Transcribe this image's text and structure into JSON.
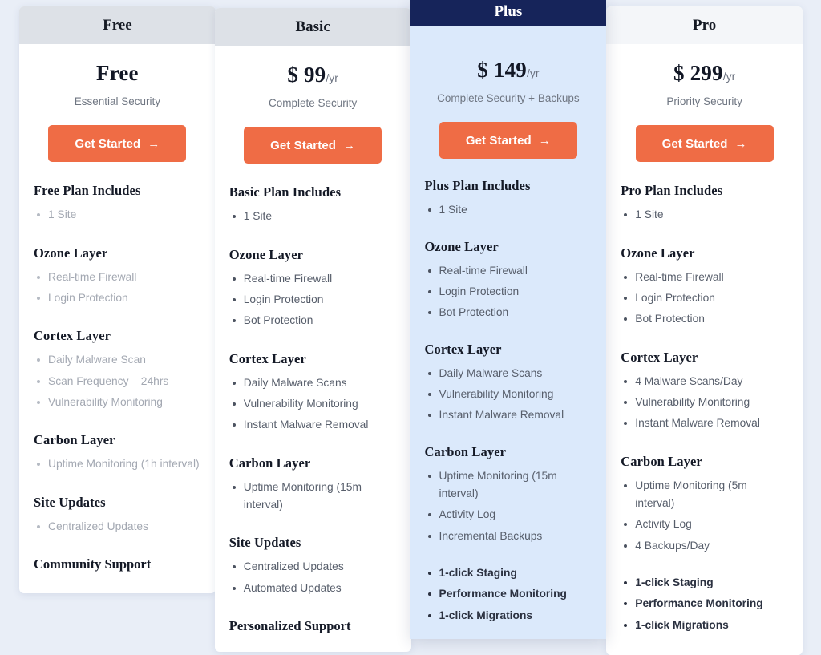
{
  "theme": {
    "page_background": "#e9eef7",
    "cta_color": "#ef6c45",
    "featured_header": "#16245a",
    "featured_body": "#dbe9fb",
    "header_gray": "#dde1e7"
  },
  "cta": {
    "label": "Get Started",
    "arrow": "→"
  },
  "plans": [
    {
      "name": "Free",
      "price": "Free",
      "period": "",
      "tagline": "Essential Security",
      "includes_title": "Free Plan Includes",
      "includes": [
        "1 Site"
      ],
      "sections": [
        {
          "title": "Ozone Layer",
          "items": [
            "Real-time Firewall",
            "Login Protection"
          ]
        },
        {
          "title": "Cortex Layer",
          "items": [
            "Daily Malware Scan",
            "Scan Frequency – 24hrs",
            "Vulnerability Monitoring"
          ]
        },
        {
          "title": "Carbon Layer",
          "items": [
            "Uptime Monitoring (1h interval)"
          ]
        },
        {
          "title": "Site Updates",
          "items": [
            "Centralized Updates"
          ]
        }
      ],
      "footer_title": "Community Support",
      "extras": []
    },
    {
      "name": "Basic",
      "price": "$ 99",
      "period": "/yr",
      "tagline": "Complete Security",
      "includes_title": "Basic Plan Includes",
      "includes": [
        "1 Site"
      ],
      "sections": [
        {
          "title": "Ozone Layer",
          "items": [
            "Real-time Firewall",
            "Login Protection",
            "Bot Protection"
          ]
        },
        {
          "title": "Cortex Layer",
          "items": [
            "Daily Malware Scans",
            "Vulnerability Monitoring",
            "Instant Malware Removal"
          ]
        },
        {
          "title": "Carbon Layer",
          "items": [
            "Uptime Monitoring (15m interval)"
          ]
        },
        {
          "title": "Site Updates",
          "items": [
            "Centralized Updates",
            "Automated Updates"
          ]
        }
      ],
      "footer_title": "Personalized Support",
      "extras": []
    },
    {
      "name": "Plus",
      "price": "$ 149",
      "period": "/yr",
      "tagline": "Complete Security + Backups",
      "includes_title": "Plus Plan Includes",
      "includes": [
        "1 Site"
      ],
      "sections": [
        {
          "title": "Ozone Layer",
          "items": [
            "Real-time Firewall",
            "Login Protection",
            "Bot Protection"
          ]
        },
        {
          "title": "Cortex Layer",
          "items": [
            "Daily Malware Scans",
            "Vulnerability Monitoring",
            "Instant Malware Removal"
          ]
        },
        {
          "title": "Carbon Layer",
          "items": [
            "Uptime Monitoring (15m interval)",
            "Activity Log",
            "Incremental Backups"
          ]
        }
      ],
      "footer_title": "",
      "extras": [
        "1-click Staging",
        "Performance Monitoring",
        "1-click Migrations"
      ]
    },
    {
      "name": "Pro",
      "price": "$ 299",
      "period": "/yr",
      "tagline": "Priority Security",
      "includes_title": "Pro Plan Includes",
      "includes": [
        "1 Site"
      ],
      "sections": [
        {
          "title": "Ozone Layer",
          "items": [
            "Real-time Firewall",
            "Login Protection",
            "Bot Protection"
          ]
        },
        {
          "title": "Cortex Layer",
          "items": [
            "4 Malware Scans/Day",
            "Vulnerability Monitoring",
            "Instant Malware Removal"
          ]
        },
        {
          "title": "Carbon Layer",
          "items": [
            "Uptime Monitoring (5m interval)",
            "Activity Log",
            "4 Backups/Day"
          ]
        }
      ],
      "footer_title": "",
      "extras": [
        "1-click Staging",
        "Performance Monitoring",
        "1-click Migrations"
      ]
    }
  ]
}
